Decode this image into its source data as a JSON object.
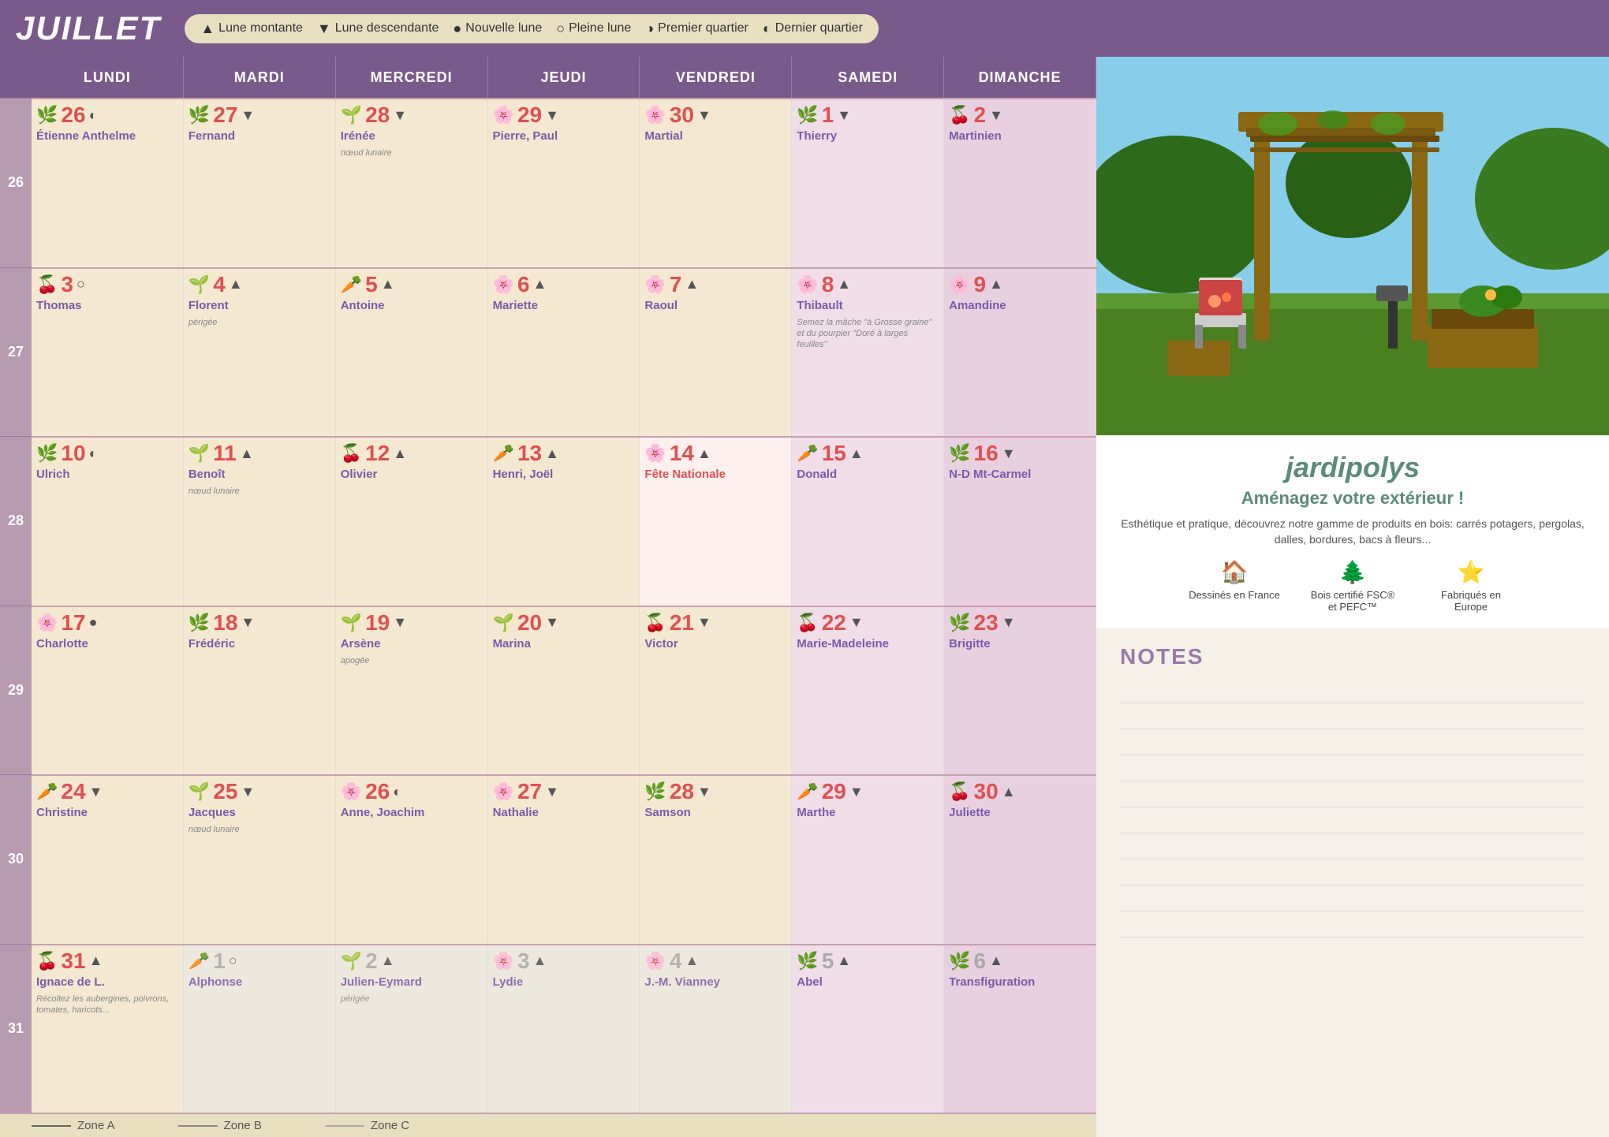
{
  "header": {
    "month": "JUILLET",
    "legend": [
      {
        "icon": "▲",
        "label": "Lune montante"
      },
      {
        "icon": "▼",
        "label": "Lune descendante"
      },
      {
        "icon": "●",
        "label": "Nouvelle lune"
      },
      {
        "icon": "○",
        "label": "Pleine lune"
      },
      {
        "icon": "◑",
        "label": "Premier quartier"
      },
      {
        "icon": "◐",
        "label": "Dernier quartier"
      }
    ]
  },
  "day_headers": [
    "LUNDI",
    "MARDI",
    "MERCREDI",
    "JEUDI",
    "VENDREDI",
    "SAMEDI",
    "DIMANCHE"
  ],
  "week_numbers": [
    "26",
    "27",
    "28",
    "29",
    "30",
    "31"
  ],
  "weeks": [
    {
      "week": "26",
      "days": [
        {
          "num": "26",
          "moon": "◐",
          "name": "Étienne Anthelme",
          "icon": "🌿",
          "type": "normal",
          "note": ""
        },
        {
          "num": "27",
          "moon": "▼",
          "name": "Fernand",
          "icon": "🌿",
          "type": "normal",
          "note": ""
        },
        {
          "num": "28",
          "moon": "▼",
          "name": "Irénée",
          "icon": "🌱",
          "type": "normal",
          "note": "nœud lunaire"
        },
        {
          "num": "29",
          "moon": "▼",
          "name": "Pierre, Paul",
          "icon": "🌸",
          "type": "normal",
          "note": ""
        },
        {
          "num": "30",
          "moon": "▼",
          "name": "Martial",
          "icon": "🌸",
          "type": "normal",
          "note": ""
        },
        {
          "num": "1",
          "moon": "▼",
          "name": "Thierry",
          "icon": "🌿",
          "type": "saturday",
          "note": ""
        },
        {
          "num": "2",
          "moon": "▼",
          "name": "Martinien",
          "icon": "🍒",
          "type": "sunday",
          "note": ""
        }
      ]
    },
    {
      "week": "27",
      "days": [
        {
          "num": "3",
          "moon": "○",
          "name": "Thomas",
          "icon": "🍒",
          "type": "normal",
          "note": ""
        },
        {
          "num": "4",
          "moon": "▲",
          "name": "Florent",
          "icon": "🌱",
          "type": "normal",
          "note": "périgée"
        },
        {
          "num": "5",
          "moon": "▲",
          "name": "Antoine",
          "icon": "🥕",
          "type": "normal",
          "note": ""
        },
        {
          "num": "6",
          "moon": "▲",
          "name": "Mariette",
          "icon": "🌸",
          "type": "normal",
          "note": ""
        },
        {
          "num": "7",
          "moon": "▲",
          "name": "Raoul",
          "icon": "🌸",
          "type": "normal",
          "note": ""
        },
        {
          "num": "8",
          "moon": "▲",
          "name": "Thibault",
          "icon": "🌸",
          "type": "saturday",
          "note": "Semez la mâche \"à Grosse graine\" et du pourpier \"Doré à larges feuilles\""
        },
        {
          "num": "9",
          "moon": "▲",
          "name": "Amandine",
          "icon": "🌸",
          "type": "sunday",
          "note": ""
        }
      ]
    },
    {
      "week": "28",
      "days": [
        {
          "num": "10",
          "moon": "◐",
          "name": "Ulrich",
          "icon": "🌿",
          "type": "normal",
          "note": ""
        },
        {
          "num": "11",
          "moon": "▲",
          "name": "Benoît",
          "icon": "🌱",
          "type": "normal",
          "note": "nœud lunaire"
        },
        {
          "num": "12",
          "moon": "▲",
          "name": "Olivier",
          "icon": "🍒",
          "type": "normal",
          "note": ""
        },
        {
          "num": "13",
          "moon": "▲",
          "name": "Henri, Joël",
          "icon": "🥕",
          "type": "normal",
          "note": ""
        },
        {
          "num": "14",
          "moon": "▲",
          "name": "Fête Nationale",
          "icon": "🌸",
          "type": "holiday",
          "note": ""
        },
        {
          "num": "15",
          "moon": "▲",
          "name": "Donald",
          "icon": "🥕",
          "type": "saturday",
          "note": ""
        },
        {
          "num": "16",
          "moon": "▼",
          "name": "N-D Mt-Carmel",
          "icon": "🌿",
          "type": "sunday",
          "note": ""
        }
      ]
    },
    {
      "week": "29",
      "days": [
        {
          "num": "17",
          "moon": "●",
          "name": "Charlotte",
          "icon": "🌸",
          "type": "normal",
          "note": ""
        },
        {
          "num": "18",
          "moon": "▼",
          "name": "Frédéric",
          "icon": "🌿",
          "type": "normal",
          "note": ""
        },
        {
          "num": "19",
          "moon": "▼",
          "name": "Arsène",
          "icon": "🌱",
          "type": "normal",
          "note": "apogée"
        },
        {
          "num": "20",
          "moon": "▼",
          "name": "Marina",
          "icon": "🌱",
          "type": "normal",
          "note": ""
        },
        {
          "num": "21",
          "moon": "▼",
          "name": "Victor",
          "icon": "🍒",
          "type": "normal",
          "note": ""
        },
        {
          "num": "22",
          "moon": "▼",
          "name": "Marie-Madeleine",
          "icon": "🍒",
          "type": "saturday",
          "note": ""
        },
        {
          "num": "23",
          "moon": "▼",
          "name": "Brigitte",
          "icon": "🌿",
          "type": "sunday",
          "note": ""
        }
      ]
    },
    {
      "week": "30",
      "days": [
        {
          "num": "24",
          "moon": "▼",
          "name": "Christine",
          "icon": "🥕",
          "type": "normal",
          "note": ""
        },
        {
          "num": "25",
          "moon": "▼",
          "name": "Jacques",
          "icon": "🌱",
          "type": "normal",
          "note": "nœud lunaire"
        },
        {
          "num": "26",
          "moon": "◐",
          "name": "Anne, Joachim",
          "icon": "🌸",
          "type": "normal",
          "note": ""
        },
        {
          "num": "27",
          "moon": "▼",
          "name": "Nathalie",
          "icon": "🌸",
          "type": "normal",
          "note": ""
        },
        {
          "num": "28",
          "moon": "▼",
          "name": "Samson",
          "icon": "🌿",
          "type": "normal",
          "note": ""
        },
        {
          "num": "29",
          "moon": "▼",
          "name": "Marthe",
          "icon": "🥕",
          "type": "saturday",
          "note": ""
        },
        {
          "num": "30",
          "moon": "▲",
          "name": "Juliette",
          "icon": "🍒",
          "type": "sunday",
          "note": ""
        }
      ]
    },
    {
      "week": "31",
      "days": [
        {
          "num": "31",
          "moon": "▲",
          "name": "Ignace de L.",
          "icon": "🍒",
          "type": "normal",
          "note": "Récoltez les aubergines, poivrons, tomates, haricots..."
        },
        {
          "num": "1",
          "moon": "○",
          "name": "Alphonse",
          "icon": "🥕",
          "type": "other",
          "note": ""
        },
        {
          "num": "2",
          "moon": "▲",
          "name": "Julien-Eymard",
          "icon": "🌱",
          "type": "other",
          "note": "périgée"
        },
        {
          "num": "3",
          "moon": "▲",
          "name": "Lydie",
          "icon": "🌸",
          "type": "other",
          "note": ""
        },
        {
          "num": "4",
          "moon": "▲",
          "name": "J.-M. Vianney",
          "icon": "🌸",
          "type": "other",
          "note": ""
        },
        {
          "num": "5",
          "moon": "▲",
          "name": "Abel",
          "icon": "🌿",
          "type": "other-sat",
          "note": ""
        },
        {
          "num": "6",
          "moon": "▲",
          "name": "Transfiguration",
          "icon": "🌿",
          "type": "other-sun",
          "note": ""
        }
      ]
    }
  ],
  "zones": [
    {
      "label": "Zone A",
      "type": "a"
    },
    {
      "label": "Zone B",
      "type": "b"
    },
    {
      "label": "Zone C",
      "type": "c"
    }
  ],
  "brand": {
    "name": "jardipolys",
    "tagline": "Aménagez votre extérieur !",
    "description": "Esthétique et pratique, découvrez notre gamme de produits en bois: carrés potagers, pergolas, dalles, bordures, bacs à fleurs...",
    "features": [
      {
        "icon": "🏠",
        "label": "Dessinés en France"
      },
      {
        "icon": "🌲",
        "label": "Bois certifié FSC® et PEFC™"
      },
      {
        "icon": "⭐",
        "label": "Fabriqués en Europe"
      }
    ]
  },
  "notes": {
    "title": "NOTES",
    "lines": 10
  }
}
